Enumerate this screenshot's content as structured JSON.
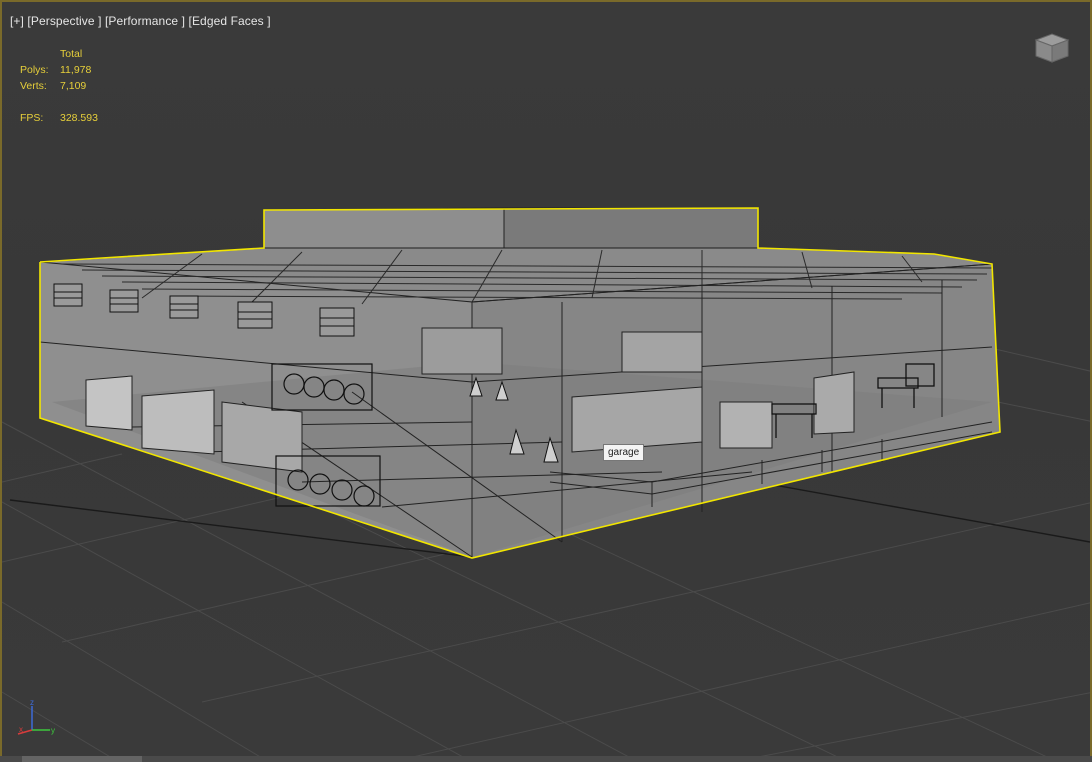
{
  "viewport": {
    "label_parts": [
      "[+]",
      "[Perspective ]",
      "[Performance ]",
      "[Edged Faces ]"
    ],
    "selection_color": "#f2e600",
    "grid_color": "#4a4a4a"
  },
  "stats": {
    "header": "Total",
    "polys_label": "Polys:",
    "polys_value": "11,978",
    "verts_label": "Verts:",
    "verts_value": "7,109",
    "fps_label": "FPS:",
    "fps_value": "328.593"
  },
  "tooltip": {
    "text": "garage"
  },
  "viewcube": {
    "icon": "viewcube-icon"
  },
  "axis_gizmo": {
    "x": "x",
    "y": "y",
    "z": "z"
  }
}
